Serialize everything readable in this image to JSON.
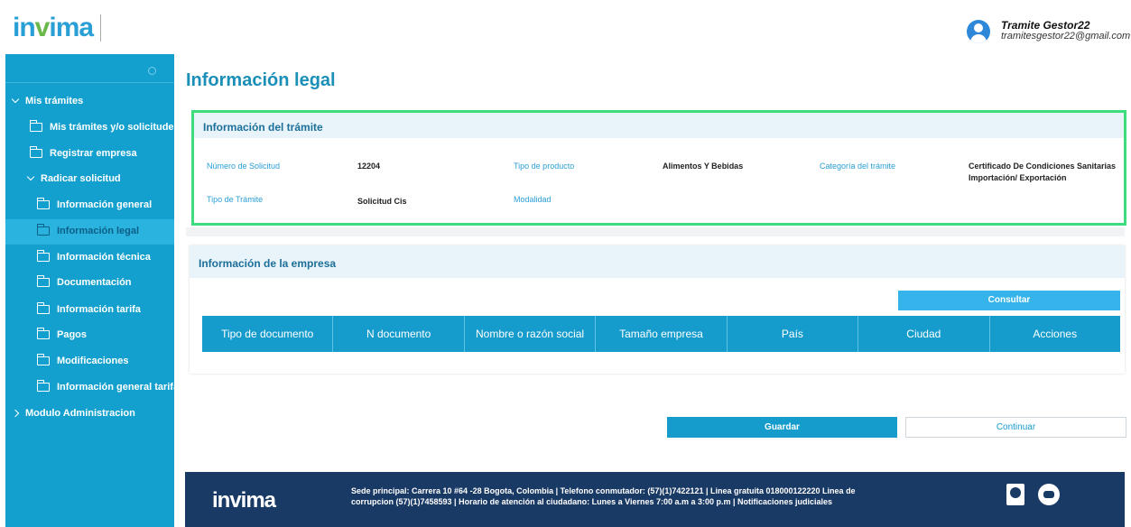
{
  "brand": {
    "logo_part1": "in",
    "logo_part2": "v",
    "logo_part3": "ima"
  },
  "user": {
    "name": "Tramite Gestor22",
    "email": "tramitesgestor22@gmail.com"
  },
  "sidebar": {
    "items": [
      {
        "label": "Mis trámites"
      },
      {
        "label": "Mis trámites y/o solicitudes"
      },
      {
        "label": "Registrar empresa"
      },
      {
        "label": "Radicar solicitud"
      },
      {
        "label": "Información general"
      },
      {
        "label": "Información legal"
      },
      {
        "label": "Información técnica"
      },
      {
        "label": "Documentación"
      },
      {
        "label": "Información tarifa"
      },
      {
        "label": "Pagos"
      },
      {
        "label": "Modificaciones"
      },
      {
        "label": "Información general tarifa"
      },
      {
        "label": "Modulo Administracion"
      }
    ]
  },
  "page": {
    "title": "Información legal"
  },
  "tramite": {
    "heading": "Información del trámite",
    "numero_label": "Número de Solicitud",
    "numero_value": "12204",
    "tipo_producto_label": "Tipo de producto",
    "tipo_producto_value": "Alimentos Y Bebidas",
    "categoria_label": "Categoría del trámite",
    "categoria_value_1": "Certificado De Condiciones Sanitarias",
    "categoria_value_2": "Importación/ Exportación",
    "tipo_tramite_label": "Tipo de Trámite",
    "tipo_tramite_value": "Solicitud Cis",
    "modalidad_label": "Modalidad"
  },
  "empresa": {
    "heading": "Información de la empresa",
    "consultar_label": "Consultar",
    "columns": [
      "Tipo de documento",
      "N documento",
      "Nombre o razón social",
      "Tamaño empresa",
      "País",
      "Ciudad",
      "Acciones"
    ]
  },
  "actions": {
    "guardar_label": "Guardar",
    "continuar_label": "Continuar"
  },
  "footer": {
    "logo": "invima",
    "line1": "Sede principal: Carrera 10 #64 -28 Bogota, Colombia | Telefono conmutador: (57)(1)7422121 | Linea gratuita 018000122220 Linea de",
    "line2": "corrupcion (57)(1)7458593 | Horario de atención al ciudadano: Lunes a Viernes 7:00 a.m a 3:00 p.m | Notificaciones judiciales"
  }
}
